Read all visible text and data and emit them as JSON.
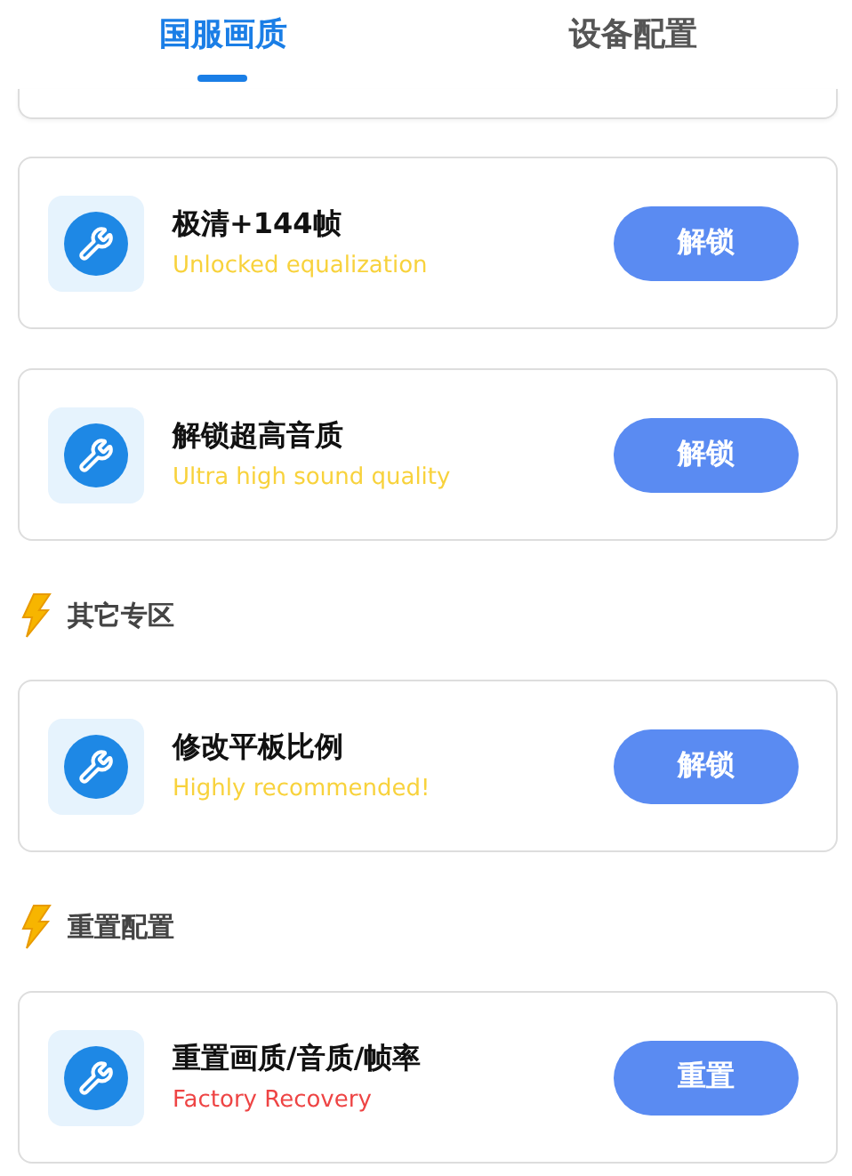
{
  "tabs": [
    {
      "label": "国服画质",
      "selected": true
    },
    {
      "label": "设备配置",
      "selected": false
    }
  ],
  "sections": [
    {
      "items": [
        {
          "title": "极清+144帧",
          "subtitle": "Unlocked equalization",
          "color": "#f8d23c",
          "button": "解锁"
        },
        {
          "title": "解锁超高音质",
          "subtitle": "Ultra high sound quality",
          "color": "#f8d23c",
          "button": "解锁"
        }
      ]
    },
    {
      "title": "其它专区",
      "items": [
        {
          "title": "修改平板比例",
          "subtitle": "Highly recommended!",
          "color": "#f8d23c",
          "button": "解锁"
        }
      ]
    },
    {
      "title": "重置配置",
      "items": [
        {
          "title": "重置画质/音质/帧率",
          "subtitle": "Factory Recovery",
          "color": "#ee4444",
          "button": "重置"
        }
      ]
    }
  ]
}
